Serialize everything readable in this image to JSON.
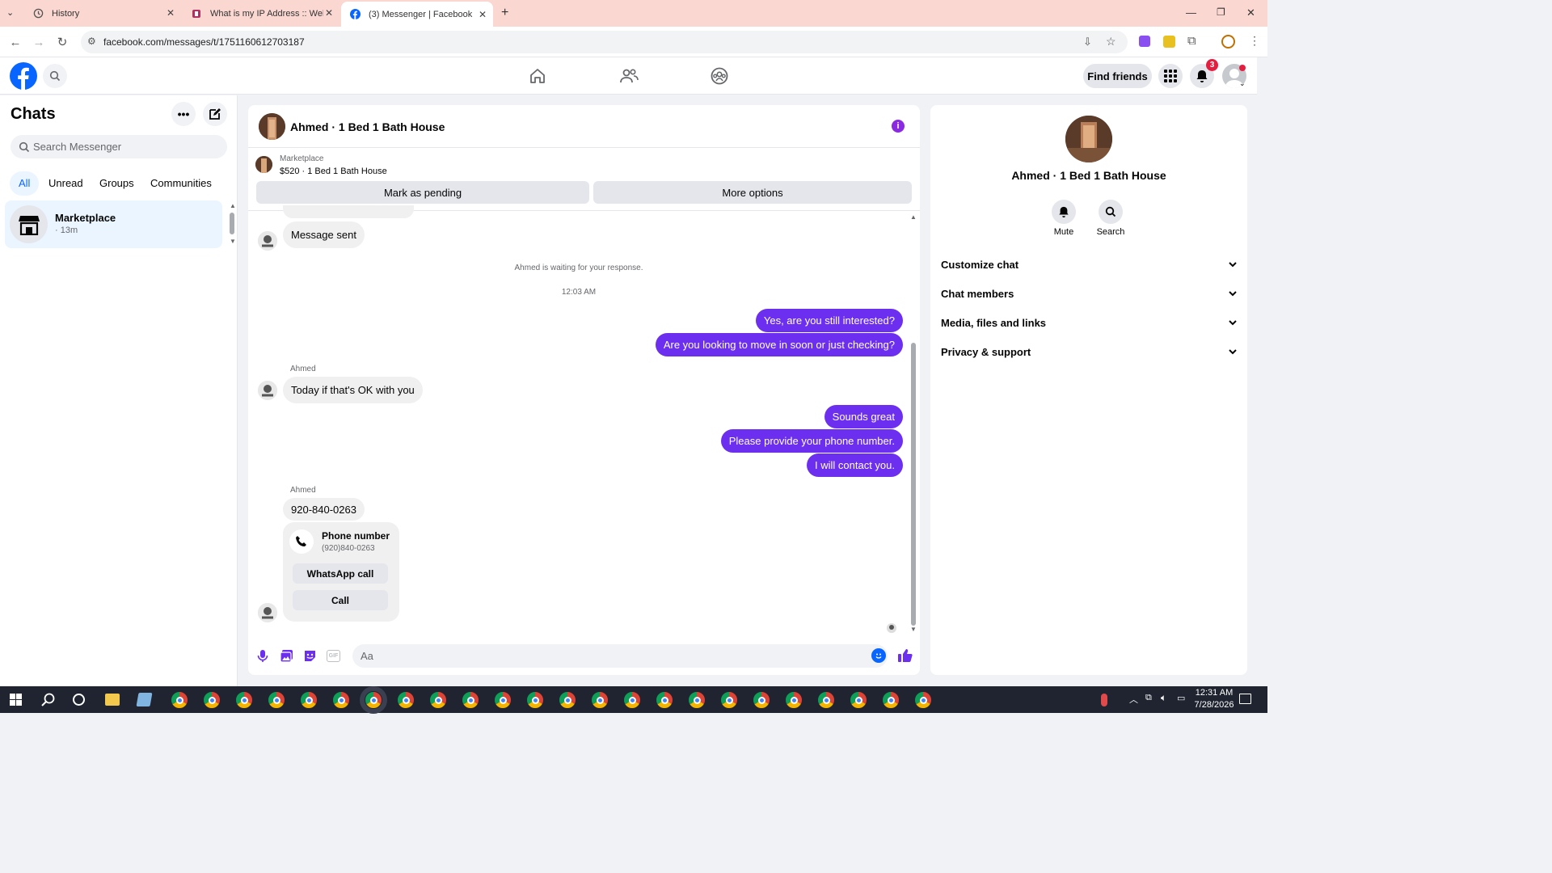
{
  "browser": {
    "tabs": [
      {
        "title": "History",
        "icon": "history-icon"
      },
      {
        "title": "What is my IP Address :: WebBr",
        "icon": "webbrowser-icon"
      },
      {
        "title": "(3) Messenger | Facebook",
        "icon": "facebook-icon"
      }
    ],
    "url": "facebook.com/messages/t/1751160612703187"
  },
  "fb": {
    "find_friends": "Find friends",
    "notif_count": "3"
  },
  "left": {
    "title": "Chats",
    "search_placeholder": "Search Messenger",
    "filters": [
      "All",
      "Unread",
      "Groups",
      "Communities"
    ],
    "chat": {
      "name": "Marketplace",
      "time": "· 13m"
    }
  },
  "main": {
    "title": "Ahmed · 1 Bed 1 Bath House",
    "listing_source": "Marketplace",
    "listing_title": "$520 · 1 Bed 1 Bath House",
    "mark_pending": "Mark as pending",
    "more_options": "More options",
    "messages": {
      "message_sent": "Message sent",
      "waiting": "Ahmed is waiting for your response.",
      "timestamp": "12:03 AM",
      "out1": "Yes, are you still interested?",
      "out2": "Are you looking to move in soon or just checking?",
      "sender1": "Ahmed",
      "in1": "Today if that's OK with you",
      "out3": "Sounds great",
      "out4": "Please provide your phone number.",
      "out5": "I will contact you.",
      "sender2": "Ahmed",
      "in2": "920-840-0263",
      "card_title": "Phone number",
      "card_number": "(920)840-0263",
      "whatsapp_call": "WhatsApp call",
      "call": "Call"
    },
    "composer_placeholder": "Aa"
  },
  "right": {
    "name": "Ahmed · 1 Bed 1 Bath House",
    "mute": "Mute",
    "search": "Search",
    "sections": [
      "Customize chat",
      "Chat members",
      "Media, files and links",
      "Privacy & support"
    ]
  },
  "taskbar": {
    "time": "12:31 AM",
    "date": "7/28/2026"
  },
  "colors": {
    "accent": "#6c2ff0",
    "fb_blue": "#0866ff",
    "tab_bg": "#fbd7d1"
  }
}
